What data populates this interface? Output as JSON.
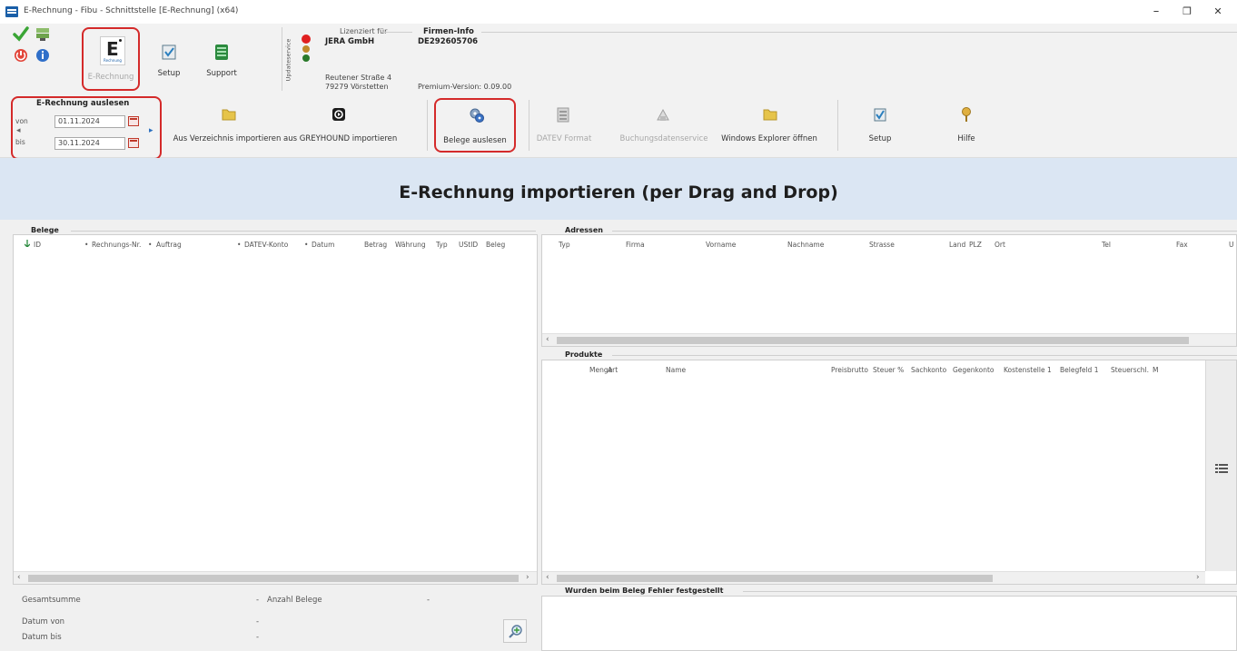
{
  "window": {
    "title": "E-Rechnung - Fibu - Schnittstelle [E-Rechnung] (x64)",
    "minimize": "–",
    "maximize": "❐",
    "close": "✕"
  },
  "toolbar1": {
    "erechnung_icon_text": "E",
    "erechnung_icon_sub": "Rechnung",
    "erechnung_label": "E-Rechnung",
    "setup_label": "Setup",
    "support_label": "Support",
    "updateservice_label": "Updateservice",
    "lizenz_title": "Lizenziert für",
    "lizenz_company": "JERA GmbH",
    "lizenz_street": "Reutener Straße 4",
    "lizenz_city": "79279 Vörstetten",
    "firmen_title": "Firmen-Info",
    "firmen_id": "DE292605706",
    "premium_version": "Premium-Version: 0.09.00"
  },
  "toolbar2": {
    "group_title": "E-Rechnung auslesen",
    "von_label": "von",
    "bis_label": "bis",
    "von_value": "01.11.2024",
    "bis_value": "30.11.2024",
    "import_dir_label": "Aus Verzeichnis importieren",
    "import_greyhound_label": "aus GREYHOUND importieren",
    "belege_label": "Belege auslesen",
    "datev_label": "DATEV Format",
    "buchung_label": "Buchungsdatenservice",
    "explorer_label": "Windows Explorer öffnen",
    "setup_label": "Setup",
    "hilfe_label": "Hilfe"
  },
  "banner": {
    "text": "E-Rechnung importieren (per Drag and Drop)"
  },
  "belege": {
    "title": "Belege",
    "columns": [
      "ID",
      "Rechnungs-Nr.",
      "Auftrag",
      "DATEV-Konto",
      "Datum",
      "Betrag",
      "Währung",
      "Typ",
      "UStID",
      "Beleg"
    ]
  },
  "adressen": {
    "title": "Adressen",
    "columns": [
      "Typ",
      "Firma",
      "Vorname",
      "Nachname",
      "Strasse",
      "Land",
      "PLZ",
      "Ort",
      "Tel",
      "Fax",
      "U"
    ]
  },
  "produkte": {
    "title": "Produkte",
    "columns": [
      "Menge",
      "Art",
      "Name",
      "Preisbrutto",
      "Steuer %",
      "Sachkonto",
      "Gegenkonto",
      "Kostenstelle 1",
      "Belegfeld 1",
      "Steuerschl.",
      "M"
    ]
  },
  "fehler": {
    "title": "Wurden beim Beleg Fehler festgestellt"
  },
  "footer": {
    "gesamtsumme_label": "Gesamtsumme",
    "gesamtsumme_value": "-",
    "anzahl_label": "Anzahl Belege",
    "anzahl_value": "-",
    "datum_von_label": "Datum von",
    "datum_von_value": "-",
    "datum_bis_label": "Datum bis",
    "datum_bis_value": "-"
  },
  "colors": {
    "accent_red": "#d42a2a",
    "banner_bg": "#dbe6f3"
  }
}
